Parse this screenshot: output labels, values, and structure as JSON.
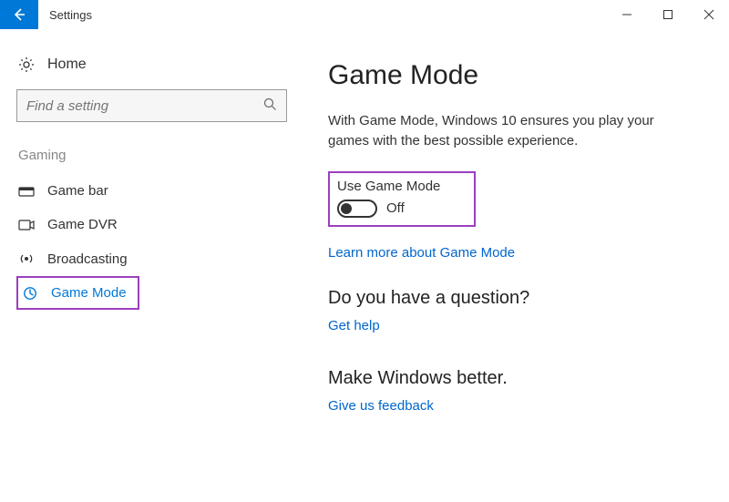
{
  "titlebar": {
    "app_title": "Settings"
  },
  "sidebar": {
    "home_label": "Home",
    "search_placeholder": "Find a setting",
    "section_label": "Gaming",
    "items": [
      {
        "label": "Game bar"
      },
      {
        "label": "Game DVR"
      },
      {
        "label": "Broadcasting"
      },
      {
        "label": "Game Mode"
      }
    ]
  },
  "main": {
    "heading": "Game Mode",
    "description": "With Game Mode, Windows 10 ensures you play your games with the best possible experience.",
    "toggle_label": "Use Game Mode",
    "toggle_state": "Off",
    "learn_more": "Learn more about Game Mode",
    "question_heading": "Do you have a question?",
    "get_help": "Get help",
    "better_heading": "Make Windows better.",
    "feedback": "Give us feedback"
  }
}
